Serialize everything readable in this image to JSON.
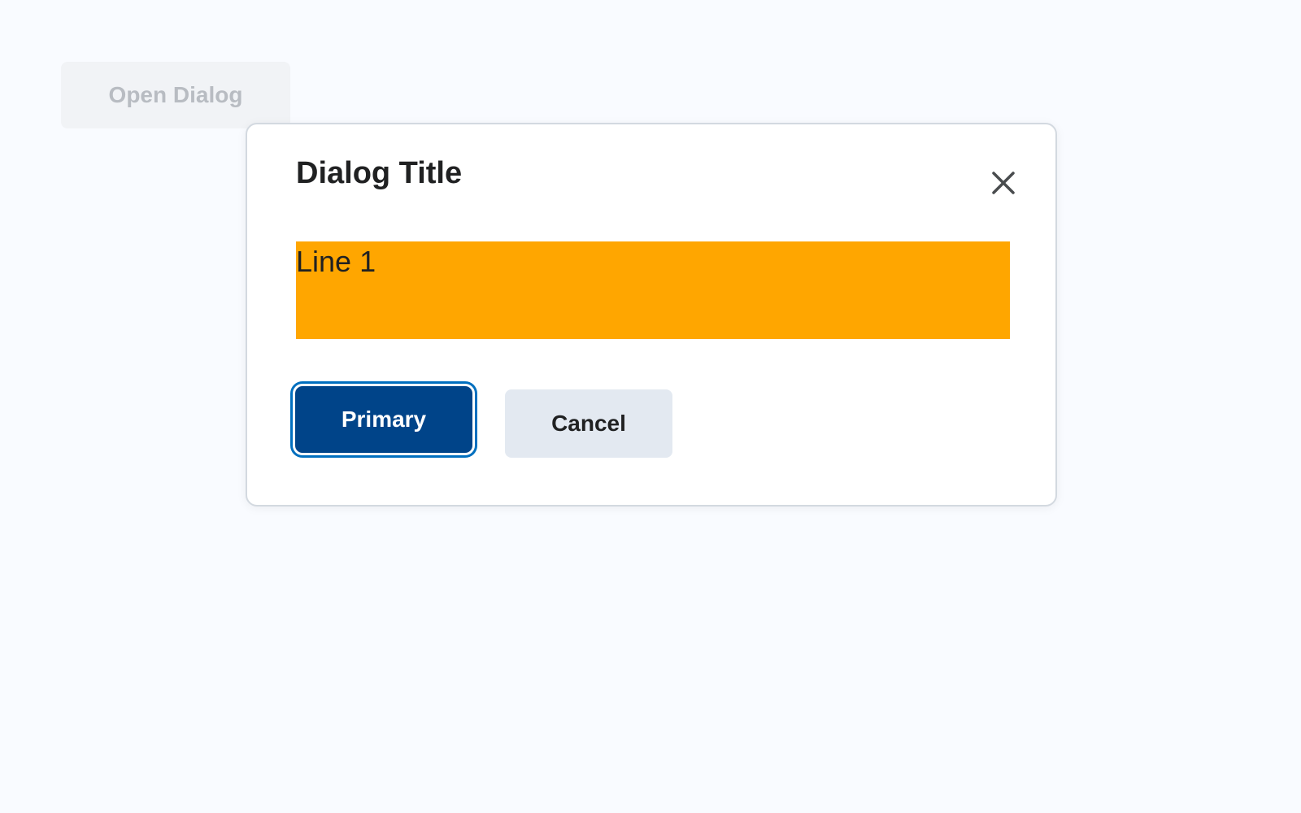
{
  "page": {
    "open_dialog_label": "Open Dialog"
  },
  "dialog": {
    "title": "Dialog Title",
    "close_icon": "close-icon",
    "content_lines": [
      "Line 1"
    ],
    "primary_label": "Primary",
    "cancel_label": "Cancel"
  },
  "colors": {
    "background": "#f9fbff",
    "content_highlight": "#ffa600",
    "primary_button": "#004489",
    "focus_ring": "#006fbf",
    "cancel_button": "#e3e9f1"
  }
}
